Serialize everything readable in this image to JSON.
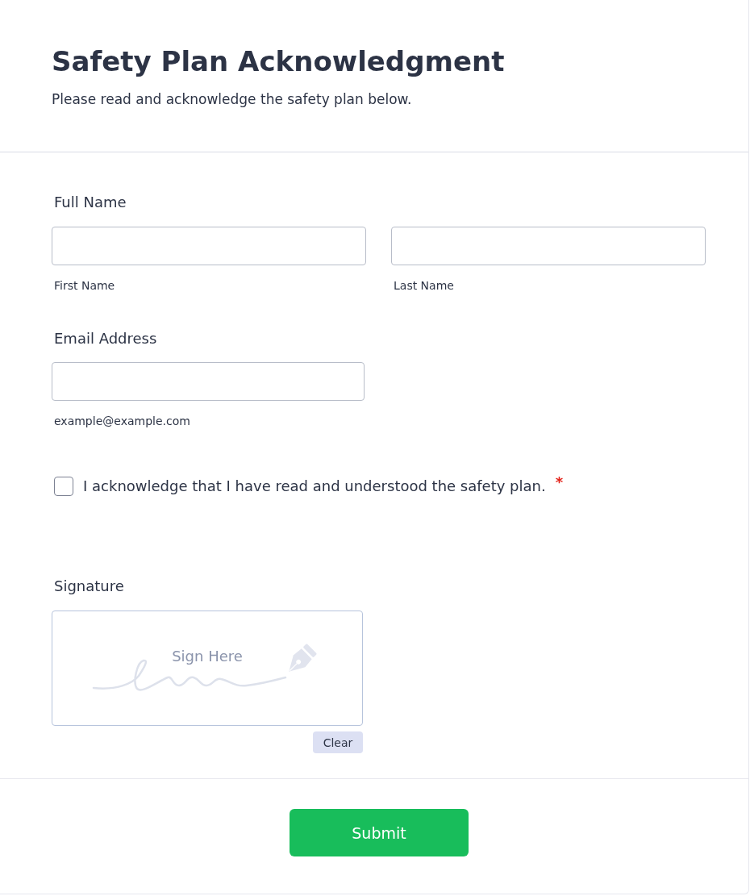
{
  "header": {
    "title": "Safety Plan Acknowledgment",
    "subtitle": "Please read and acknowledge the safety plan below."
  },
  "fields": [
    {
      "kind": "name",
      "label": "Full Name",
      "inputs": [
        {
          "sublabel": "First Name"
        },
        {
          "sublabel": "Last Name"
        }
      ]
    },
    {
      "kind": "email",
      "label": "Email Address",
      "inputs": [
        {
          "sublabel": "example@example.com"
        }
      ]
    },
    {
      "kind": "checkbox",
      "label": "I acknowledge that I have read and understood the safety plan.",
      "checked": false,
      "required_mark": "*"
    },
    {
      "kind": "signature",
      "label": "Signature",
      "placeholder": "Sign Here",
      "clear_button": "Clear"
    }
  ],
  "submit_button": "Submit"
}
